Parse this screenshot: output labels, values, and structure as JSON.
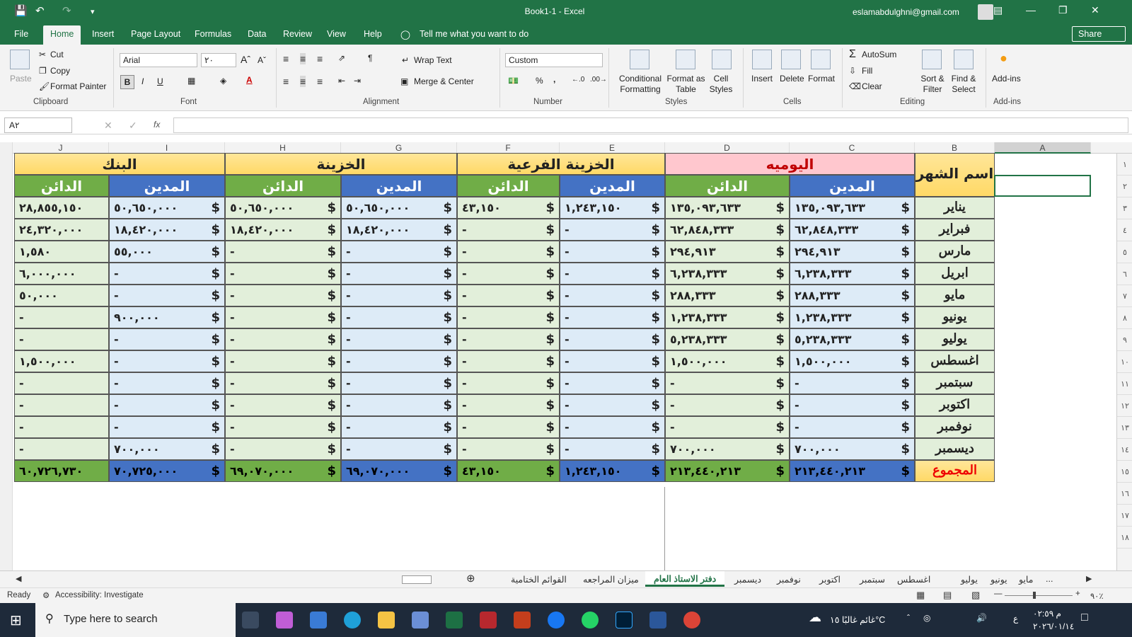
{
  "titlebar": {
    "title": "Book1-1  -  Excel",
    "account": "eslamabdulghni@gmail.com",
    "save_icon": "save-icon",
    "undo_icon": "undo-icon",
    "redo_icon": "redo-icon"
  },
  "menu": {
    "items": [
      "File",
      "Home",
      "Insert",
      "Page Layout",
      "Formulas",
      "Data",
      "Review",
      "View",
      "Help"
    ],
    "tell_me": "Tell me what you want to do",
    "share": "Share"
  },
  "ribbon": {
    "clipboard": {
      "paste": "Paste",
      "cut": "Cut",
      "copy": "Copy",
      "format_painter": "Format Painter",
      "label": "Clipboard"
    },
    "font": {
      "name": "Arial",
      "size": "۲۰",
      "bold": "B",
      "italic": "I",
      "underline": "U",
      "label": "Font"
    },
    "alignment": {
      "wrap": "Wrap Text",
      "merge": "Merge & Center",
      "label": "Alignment"
    },
    "number": {
      "format": "Custom",
      "percent": "%",
      "comma": ",",
      "label": "Number"
    },
    "styles": {
      "conditional": "Conditional Formatting",
      "format_table": "Format as Table",
      "cell_styles": "Cell Styles",
      "label": "Styles"
    },
    "cells": {
      "insert": "Insert",
      "delete": "Delete",
      "format": "Format",
      "label": "Cells"
    },
    "editing": {
      "autosum": "AutoSum",
      "fill": "Fill",
      "clear": "Clear",
      "sort": "Sort & Filter",
      "find": "Find & Select",
      "label": "Editing"
    },
    "addins": {
      "addins": "Add-ins",
      "label": "Add-ins"
    }
  },
  "formula_bar": {
    "name_box": "A۲",
    "fx": "fx",
    "value": ""
  },
  "columns": [
    "J",
    "I",
    "H",
    "G",
    "F",
    "E",
    "D",
    "C",
    "B",
    "A"
  ],
  "rows": [
    "۱",
    "۲",
    "۳",
    "٤",
    "٥",
    "٦",
    "۷",
    "۸",
    "۹",
    "۱۰",
    "۱۱",
    "۱۲",
    "۱۳",
    "۱٤",
    "۱٥",
    "۱٦",
    "۱۷",
    "۱۸"
  ],
  "table": {
    "groups": {
      "bank": "البنك",
      "treasury": "الخزينة",
      "sub_treasury": "الخزينة الفرعية",
      "journal": "اليوميه",
      "month_name": "اسم الشهر"
    },
    "debit": "المدين",
    "credit": "الدائن",
    "currency": "$",
    "total_label": "المجموع",
    "months": [
      "يناير",
      "فبراير",
      "مارس",
      "ابريل",
      "مايو",
      "يونيو",
      "يوليو",
      "اغسطس",
      "سبتمبر",
      "اكتوبر",
      "نوفمبر",
      "ديسمبر"
    ],
    "data": [
      {
        "J": "۲۸,۸٥٥,۱٥۰",
        "I": "٥۰,٦٥۰,۰۰۰",
        "H": "٥۰,٦٥۰,۰۰۰",
        "G": "٥۰,٦٥۰,۰۰۰",
        "F": "٤۳,۱٥۰",
        "E": "۱,۲٤۳,۱٥۰",
        "D": "۱۳٥,۰۹۳,٦۳۳",
        "C": "۱۳٥,۰۹۳,٦۳۳"
      },
      {
        "J": "۲٤,۳۲۰,۰۰۰",
        "I": "۱۸,٤۲۰,۰۰۰",
        "H": "۱۸,٤۲۰,۰۰۰",
        "G": "۱۸,٤۲۰,۰۰۰",
        "F": "-",
        "E": "-",
        "D": "٦۲,۸٤۸,۳۳۳",
        "C": "٦۲,۸٤۸,۳۳۳"
      },
      {
        "J": "۱,٥۸۰",
        "I": "٥٥,۰۰۰",
        "H": "-",
        "G": "-",
        "F": "-",
        "E": "-",
        "D": "۲۹٤,۹۱۳",
        "C": "۲۹٤,۹۱۳"
      },
      {
        "J": "٦,۰۰۰,۰۰۰",
        "I": "-",
        "H": "-",
        "G": "-",
        "F": "-",
        "E": "-",
        "D": "٦,۲۳۸,۳۳۳",
        "C": "٦,۲۳۸,۳۳۳"
      },
      {
        "J": "٥۰,۰۰۰",
        "I": "-",
        "H": "-",
        "G": "-",
        "F": "-",
        "E": "-",
        "D": "۲۸۸,۳۳۳",
        "C": "۲۸۸,۳۳۳"
      },
      {
        "J": "-",
        "I": "۹۰۰,۰۰۰",
        "H": "-",
        "G": "-",
        "F": "-",
        "E": "-",
        "D": "۱,۲۳۸,۳۳۳",
        "C": "۱,۲۳۸,۳۳۳"
      },
      {
        "J": "-",
        "I": "-",
        "H": "-",
        "G": "-",
        "F": "-",
        "E": "-",
        "D": "٥,۲۳۸,۳۳۳",
        "C": "٥,۲۳۸,۳۳۳"
      },
      {
        "J": "۱,٥۰۰,۰۰۰",
        "I": "-",
        "H": "-",
        "G": "-",
        "F": "-",
        "E": "-",
        "D": "۱,٥۰۰,۰۰۰",
        "C": "۱,٥۰۰,۰۰۰"
      },
      {
        "J": "-",
        "I": "-",
        "H": "-",
        "G": "-",
        "F": "-",
        "E": "-",
        "D": "-",
        "C": "-"
      },
      {
        "J": "-",
        "I": "-",
        "H": "-",
        "G": "-",
        "F": "-",
        "E": "-",
        "D": "-",
        "C": "-"
      },
      {
        "J": "-",
        "I": "-",
        "H": "-",
        "G": "-",
        "F": "-",
        "E": "-",
        "D": "-",
        "C": "-"
      },
      {
        "J": "-",
        "I": "۷۰۰,۰۰۰",
        "H": "-",
        "G": "-",
        "F": "-",
        "E": "-",
        "D": "۷۰۰,۰۰۰",
        "C": "۷۰۰,۰۰۰"
      }
    ],
    "totals": {
      "J": "٦۰,۷۲٦,۷۳۰",
      "I": "۷۰,۷۲٥,۰۰۰",
      "H": "٦۹,۰۷۰,۰۰۰",
      "G": "٦۹,۰۷۰,۰۰۰",
      "F": "٤۳,۱٥۰",
      "E": "۱,۲٤۳,۱٥۰",
      "D": "۲۱۳,٤٤۰,۲۱۳",
      "C": "۲۱۳,٤٤۰,۲۱۳"
    }
  },
  "sheet_tabs": [
    "...",
    "مايو",
    "يونيو",
    "يوليو",
    "اغسطس",
    "سبتمبر",
    "اكتوبر",
    "نوفمبر",
    "ديسمبر",
    "دفتر الاستاذ العام",
    "ميزان المراجعه",
    "القوائم الختامية"
  ],
  "active_tab": "دفتر الاستاذ العام",
  "status": {
    "ready": "Ready",
    "accessibility": "Accessibility: Investigate",
    "zoom": "۹۰٪"
  },
  "taskbar": {
    "search_placeholder": "Type here to search",
    "weather": "غائم غالبًا  ۱٥°C",
    "time": "۰۲:٥۹ م",
    "date": "۲۰۲٦/۰۱/۱٤",
    "lang": "ع"
  },
  "colors": {
    "excel_green": "#217346",
    "blue_header": "#4472c4",
    "green_header": "#70ad47",
    "light_blue": "#ddebf7",
    "light_green": "#e2efda",
    "yellow": "#ffd966",
    "pink": "#ffc7ce"
  }
}
